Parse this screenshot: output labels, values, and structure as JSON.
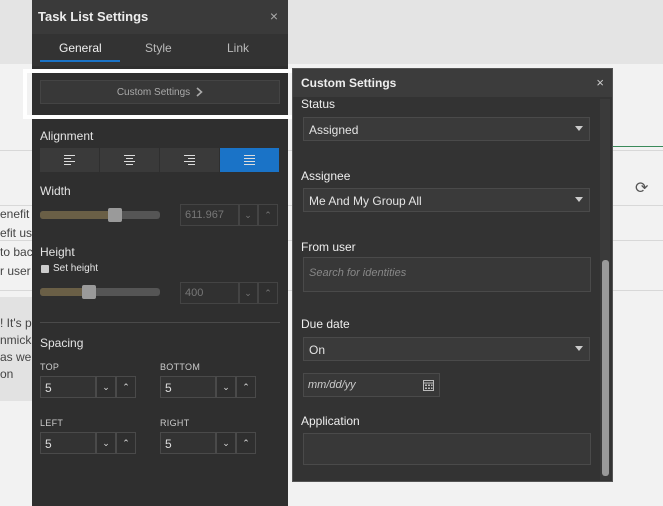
{
  "background": {
    "text_lines": [
      "enefit",
      "efit us",
      "to bac",
      "r user",
      "! It's p",
      "nmick",
      "as wel",
      "on"
    ]
  },
  "panel": {
    "title": "Task List Settings",
    "close": "×",
    "tabs": [
      {
        "label": "General",
        "active": true
      },
      {
        "label": "Style",
        "active": false
      },
      {
        "label": "Link",
        "active": false
      }
    ],
    "custom_settings_label": "Custom Settings",
    "alignment_label": "Alignment",
    "alignment_options": [
      "left",
      "center",
      "right",
      "justify"
    ],
    "alignment_selected": "justify",
    "width_label": "Width",
    "width_value": "611.967",
    "height_label": "Height",
    "set_height_label": "Set height",
    "height_value": "400",
    "spacing_label": "Spacing",
    "spacing": {
      "top_label": "TOP",
      "top_value": "5",
      "bottom_label": "BOTTOM",
      "bottom_value": "5",
      "left_label": "LEFT",
      "left_value": "5",
      "right_label": "RIGHT",
      "right_value": "5"
    }
  },
  "dialog": {
    "title": "Custom Settings",
    "close": "×",
    "status_label": "Status",
    "status_value": "Assigned",
    "assignee_label": "Assignee",
    "assignee_value": "Me And My Group All",
    "from_user_label": "From user",
    "from_user_placeholder": "Search for identities",
    "due_date_label": "Due date",
    "due_date_value": "On",
    "date_placeholder": "mm/dd/yy",
    "application_label": "Application"
  },
  "colors": {
    "accent": "#1a73c7",
    "panel_bg": "#2f2f2f",
    "dialog_bg": "#333333",
    "highlight": "#ffffff"
  }
}
